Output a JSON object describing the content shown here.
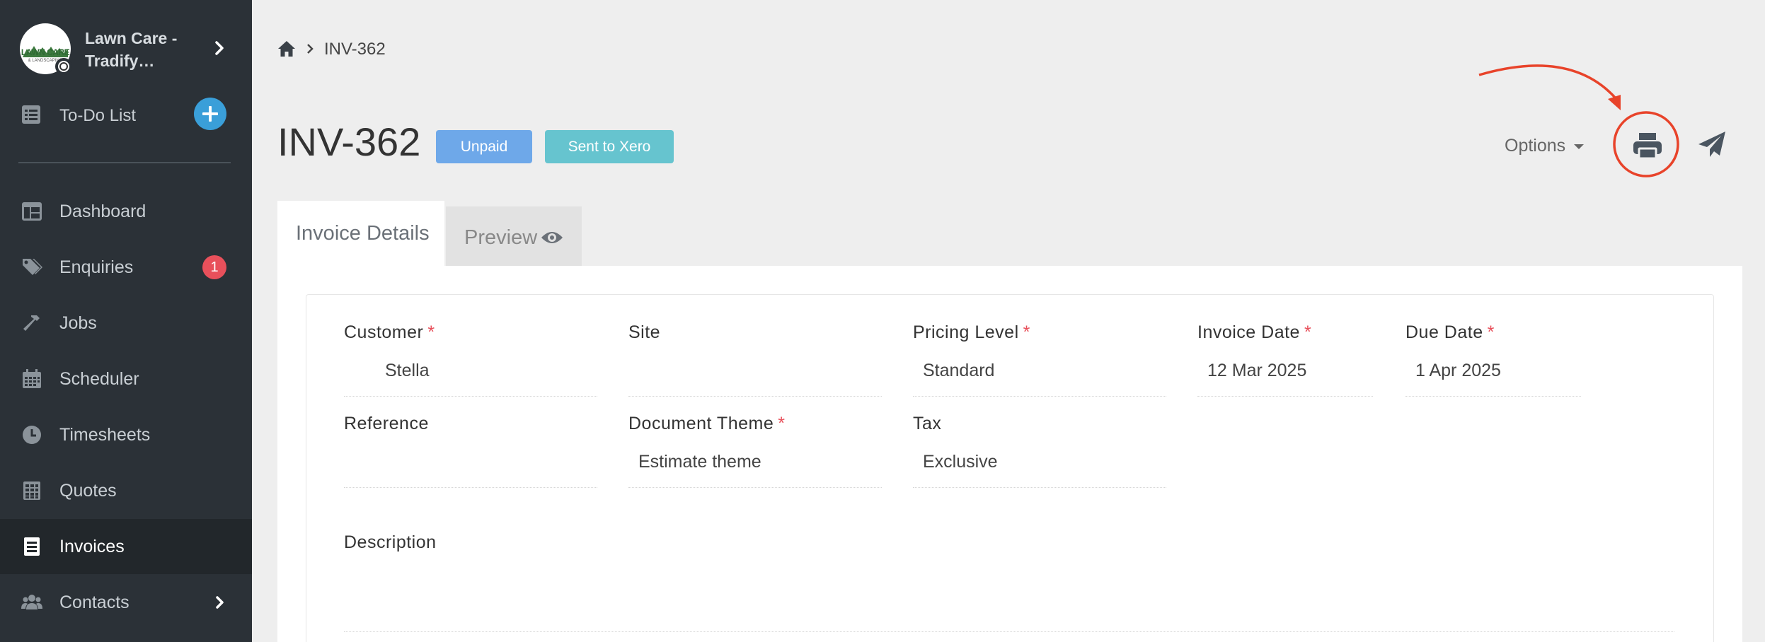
{
  "sidebar": {
    "brand": {
      "name": "Lawn Care - Tradify…",
      "logo_text": "LAWN CARE",
      "logo_subtext": "& LANDSCAPING"
    },
    "todo": {
      "label": "To-Do List"
    },
    "items": [
      {
        "label": "Dashboard",
        "icon": "dashboard-icon"
      },
      {
        "label": "Enquiries",
        "icon": "tags-icon",
        "badge": "1"
      },
      {
        "label": "Jobs",
        "icon": "hammer-icon"
      },
      {
        "label": "Scheduler",
        "icon": "calendar-icon"
      },
      {
        "label": "Timesheets",
        "icon": "clock-icon"
      },
      {
        "label": "Quotes",
        "icon": "calculator-icon"
      },
      {
        "label": "Invoices",
        "icon": "invoice-icon",
        "active": true
      },
      {
        "label": "Contacts",
        "icon": "users-icon"
      }
    ]
  },
  "breadcrumb": {
    "current": "INV-362"
  },
  "header": {
    "title": "INV-362",
    "status_badge": "Unpaid",
    "sync_badge": "Sent to Xero",
    "options_label": "Options"
  },
  "tabs": [
    {
      "label": "Invoice Details",
      "active": true
    },
    {
      "label": "Preview",
      "active": false
    }
  ],
  "form": {
    "customer": {
      "label": "Customer",
      "value": "Stella"
    },
    "site": {
      "label": "Site",
      "value": ""
    },
    "pricing_level": {
      "label": "Pricing Level",
      "value": "Standard"
    },
    "invoice_date": {
      "label": "Invoice Date",
      "value": "12 Mar 2025"
    },
    "due_date": {
      "label": "Due Date",
      "value": "1 Apr 2025"
    },
    "reference": {
      "label": "Reference",
      "value": ""
    },
    "document_theme": {
      "label": "Document Theme",
      "value": "Estimate theme"
    },
    "tax": {
      "label": "Tax",
      "value": "Exclusive"
    },
    "description": {
      "label": "Description",
      "value": ""
    },
    "required_mark": "*"
  },
  "colors": {
    "sidebar_bg": "#2b3137",
    "accent_blue": "#3a9fd9",
    "unpaid": "#6ea8e9",
    "xero": "#66c4cf",
    "badge_red": "#e8505b",
    "annotation_red": "#e8432a"
  }
}
